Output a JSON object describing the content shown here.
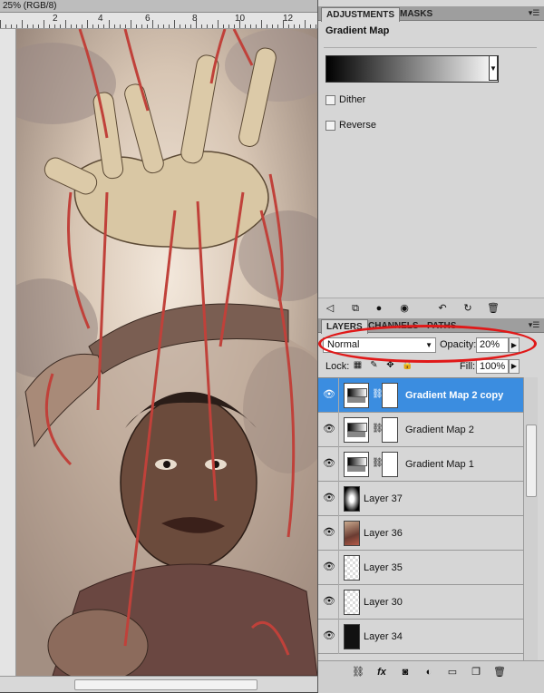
{
  "document": {
    "tab_title": "25% (RGB/8)",
    "ruler_numbers": [
      "2",
      "4",
      "6",
      "8",
      "10",
      "12"
    ]
  },
  "adjustments_panel": {
    "tabs": [
      "ADJUSTMENTS",
      "MASKS"
    ],
    "title": "Gradient Map",
    "options": [
      "Dither",
      "Reverse"
    ],
    "bottom_icons": [
      "back-arrow-icon",
      "panel-switch-icon",
      "clip-icon",
      "eye-icon",
      "previous-state-icon",
      "reset-icon",
      "trash-icon"
    ]
  },
  "layers_panel": {
    "tabs": [
      "LAYERS",
      "CHANNELS",
      "PATHS"
    ],
    "blend_mode": "Normal",
    "opacity_label": "Opacity:",
    "opacity_value": "20%",
    "lock_label": "Lock:",
    "fill_label": "Fill:",
    "fill_value": "100%",
    "layers": [
      {
        "name": "Gradient Map 2 copy",
        "kind": "adjustment",
        "selected": true
      },
      {
        "name": "Gradient Map 2",
        "kind": "adjustment",
        "selected": false
      },
      {
        "name": "Gradient Map 1",
        "kind": "adjustment",
        "selected": false
      },
      {
        "name": "Layer 37",
        "kind": "gradient",
        "selected": false
      },
      {
        "name": "Layer 36",
        "kind": "image",
        "selected": false
      },
      {
        "name": "Layer 35",
        "kind": "transparent",
        "selected": false
      },
      {
        "name": "Layer 30",
        "kind": "transparent",
        "selected": false
      },
      {
        "name": "Layer 34",
        "kind": "dark",
        "selected": false
      }
    ],
    "bottom_icons": [
      "link-icon",
      "fx-icon",
      "mask-icon",
      "adjustment-icon",
      "group-icon",
      "new-layer-icon",
      "trash-icon"
    ]
  },
  "colors": {
    "selection_highlight": "#3b8de0",
    "annotation_red": "#e01818",
    "string_red": "#c0413a"
  }
}
